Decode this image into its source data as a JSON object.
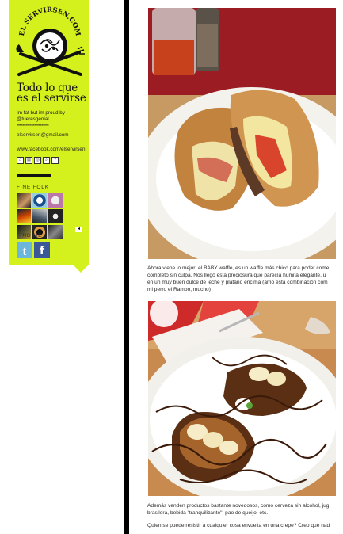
{
  "sidebar": {
    "logo_text": "EL SERVIRSEN.COM",
    "tagline_line1": "Todo lo que",
    "tagline_line2": "es el servirse",
    "desc_line1": "Im fat but im proud by",
    "desc_line2": "@tueresgenial",
    "stars": "**********************",
    "email": "elservirsen@gmail.com",
    "facebook": "www.facebook.com/elservirsen",
    "fine_folk_label": "FINE FOLK",
    "find_me_label": "FIND ME",
    "twitter_glyph": "t",
    "facebook_glyph": "f",
    "arrow_glyph": "◂"
  },
  "folk_icons": [
    "folk-1",
    "folk-2",
    "folk-3",
    "folk-4",
    "folk-5",
    "folk-6",
    "folk-7",
    "folk-8",
    "folk-9"
  ],
  "post": {
    "para1": [
      "Ahora viene lo mejor: el BABY waffle, es un waffle más chico para poder come",
      "completo sin culpa. Nos llegó esta preciosura que parecía humita elegante, u",
      "en un muy buen dulce de leche y plátano encima (amo esta combinación com",
      "mi perro el Rambo, mucho)"
    ],
    "para2": [
      "Además venden productos bastante novedosos, como cerveza sin alcohol, jug",
      "brasilera, bebida \"tranquilizante\", pao de queijo, etc."
    ],
    "para3": [
      "Quien se puede resistir a cualquier cosa envuelta en una crepe? Creo que nad"
    ]
  },
  "colors": {
    "sidebar_bg": "#d4f11d",
    "divider": "#000000"
  }
}
